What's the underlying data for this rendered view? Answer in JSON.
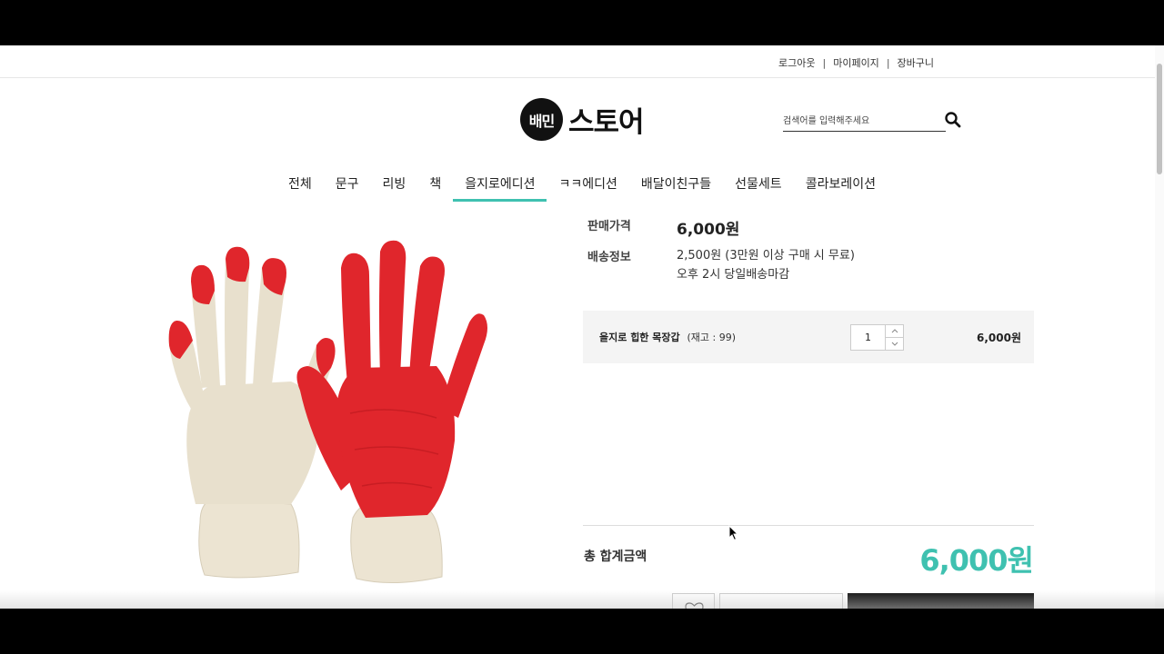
{
  "util": {
    "logout": "로그아웃",
    "mypage": "마이페이지",
    "cart": "장바구니",
    "sep": "|"
  },
  "logo": {
    "badge": "배민",
    "text": "스토어"
  },
  "search": {
    "placeholder": "검색어를 입력해주세요",
    "icon": "search-icon"
  },
  "nav": {
    "items": [
      "전체",
      "문구",
      "리빙",
      "책",
      "을지로에디션",
      "ㅋㅋ에디션",
      "배달이친구들",
      "선물세트",
      "콜라보레이션"
    ],
    "active_index": 4
  },
  "product": {
    "price_label": "판매가격",
    "price": "6,000원",
    "shipping_label": "배송정보",
    "shipping_line1": "2,500원 (3만원 이상 구매 시 무료)",
    "shipping_line2": "오후 2시 당일배송마감"
  },
  "option": {
    "name": "을지로 힙한 목장갑",
    "stock": "(재고 : 99)",
    "quantity": "1",
    "price": "6,000원"
  },
  "total": {
    "label": "총 합계금액",
    "value": "6,000원"
  },
  "colors": {
    "accent": "#3fc1b0",
    "glove_red": "#e0262c",
    "glove_cotton": "#ece4d2"
  }
}
